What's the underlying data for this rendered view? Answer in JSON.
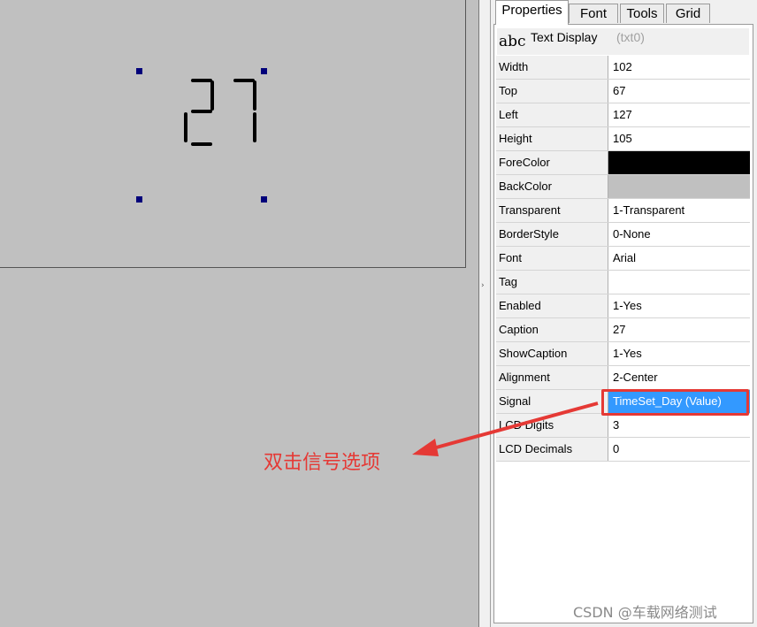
{
  "tabs": [
    "Properties",
    "Font",
    "Tools",
    "Grid"
  ],
  "header": {
    "type_label": "abc",
    "title": "Text Display",
    "id": "(txt0)"
  },
  "lcd_value": "27",
  "properties": [
    {
      "name": "Width",
      "value": "102"
    },
    {
      "name": "Top",
      "value": "67"
    },
    {
      "name": "Left",
      "value": "127"
    },
    {
      "name": "Height",
      "value": "105"
    },
    {
      "name": "ForeColor",
      "value": ""
    },
    {
      "name": "BackColor",
      "value": ""
    },
    {
      "name": "Transparent",
      "value": "1-Transparent"
    },
    {
      "name": "BorderStyle",
      "value": "0-None"
    },
    {
      "name": "Font",
      "value": "Arial"
    },
    {
      "name": "Tag",
      "value": ""
    },
    {
      "name": "Enabled",
      "value": "1-Yes"
    },
    {
      "name": "Caption",
      "value": "27"
    },
    {
      "name": "ShowCaption",
      "value": "1-Yes"
    },
    {
      "name": "Alignment",
      "value": "2-Center"
    },
    {
      "name": "Signal",
      "value": "TimeSet_Day (Value)"
    },
    {
      "name": "LCD Digits",
      "value": "3"
    },
    {
      "name": "LCD Decimals",
      "value": "0"
    }
  ],
  "colors": {
    "forecolor": "#000000",
    "backcolor": "#c0c0c0",
    "selection": "#3399ff",
    "annotation": "#e53935"
  },
  "annotation": "双击信号选项",
  "watermark": "CSDN @车载网络测试"
}
